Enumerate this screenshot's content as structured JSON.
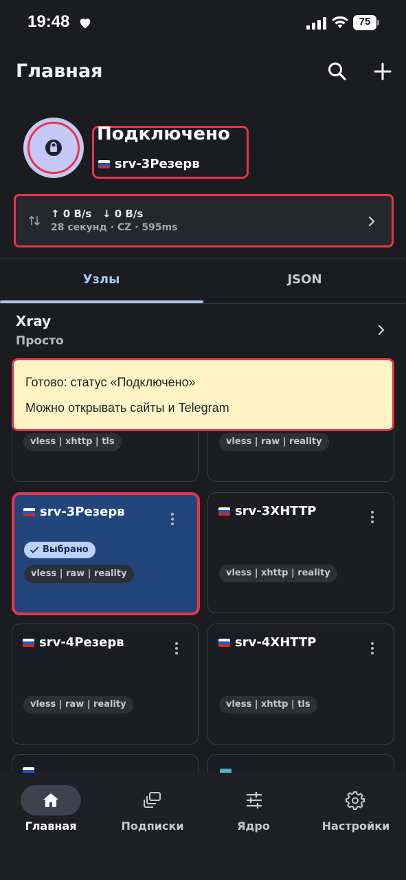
{
  "status_bar": {
    "time": "19:48",
    "battery": "75"
  },
  "header": {
    "title": "Главная"
  },
  "connection": {
    "status": "Подключено",
    "server": "srv-3Резерв"
  },
  "stats": {
    "up": "↑ 0 B/s",
    "down": "↓ 0 B/s",
    "details": "28 секунд · CZ · 595ms"
  },
  "tabs": [
    {
      "label": "Узлы",
      "active": true
    },
    {
      "label": "JSON",
      "active": false
    }
  ],
  "core": {
    "title": "Xray",
    "subtitle": "Просто"
  },
  "toast": {
    "line1": "Готово: статус «Подключено»",
    "line2": "Можно открывать сайты и Telegram"
  },
  "nodes": [
    {
      "name": "",
      "tags": "vless | xhttp | tls",
      "selected": false
    },
    {
      "name": "",
      "tags": "vless | raw | reality",
      "selected": false
    },
    {
      "name": "srv-3Резерв",
      "tags": "vless | raw | reality",
      "selected": true,
      "badge": "Выбрано"
    },
    {
      "name": "srv-3XHTTP",
      "tags": "vless | xhttp | reality",
      "selected": false
    },
    {
      "name": "srv-4Резерв",
      "tags": "vless | raw | reality",
      "selected": false
    },
    {
      "name": "srv-4XHTTP",
      "tags": "vless | xhttp | tls",
      "selected": false
    }
  ],
  "bottom_nav": [
    {
      "label": "Главная",
      "icon": "home-icon",
      "active": true
    },
    {
      "label": "Подписки",
      "icon": "subscriptions-icon",
      "active": false
    },
    {
      "label": "Ядро",
      "icon": "sliders-icon",
      "active": false
    },
    {
      "label": "Настройки",
      "icon": "gear-icon",
      "active": false
    }
  ],
  "colors": {
    "background": "#1b1c20",
    "accent": "#a9c7f2",
    "highlight": "#e8344a",
    "selected_card": "#22467c",
    "toast": "#fff4c6"
  }
}
